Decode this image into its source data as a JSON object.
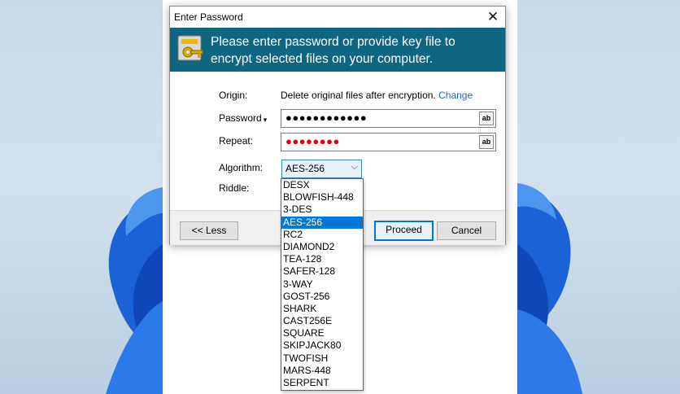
{
  "dialog": {
    "title": "Enter Password",
    "close_glyph": "✕",
    "banner_text": "Please enter password or provide key file to encrypt selected files on your computer.",
    "banner_icon": "key-icon"
  },
  "form": {
    "origin_label": "Origin:",
    "origin_value": "Delete original files after encryption.",
    "origin_link": "Change",
    "password_label": "Password",
    "password_dropdown_glyph": "▼",
    "password_mask": "●●●●●●●●●●●●",
    "repeat_label": "Repeat:",
    "repeat_mask": "●●●●●●●●",
    "show_text_glyph": "ab",
    "algorithm_label": "Algorithm:",
    "algorithm_value": "AES-256",
    "algorithm_chevron": "⌵",
    "riddle_label": "Riddle:"
  },
  "algorithm_options": [
    "DESX",
    "BLOWFISH-448",
    "3-DES",
    "AES-256",
    "RC2",
    "DIAMOND2",
    "TEA-128",
    "SAFER-128",
    "3-WAY",
    "GOST-256",
    "SHARK",
    "CAST256E",
    "SQUARE",
    "SKIPJACK80",
    "TWOFISH",
    "MARS-448",
    "SERPENT"
  ],
  "buttons": {
    "less": "<< Less",
    "proceed": "Proceed",
    "cancel": "Cancel"
  },
  "colors": {
    "banner": "#0f6681",
    "accent": "#0078d7",
    "link": "#1a66b5",
    "mask_red": "#e0001b"
  }
}
